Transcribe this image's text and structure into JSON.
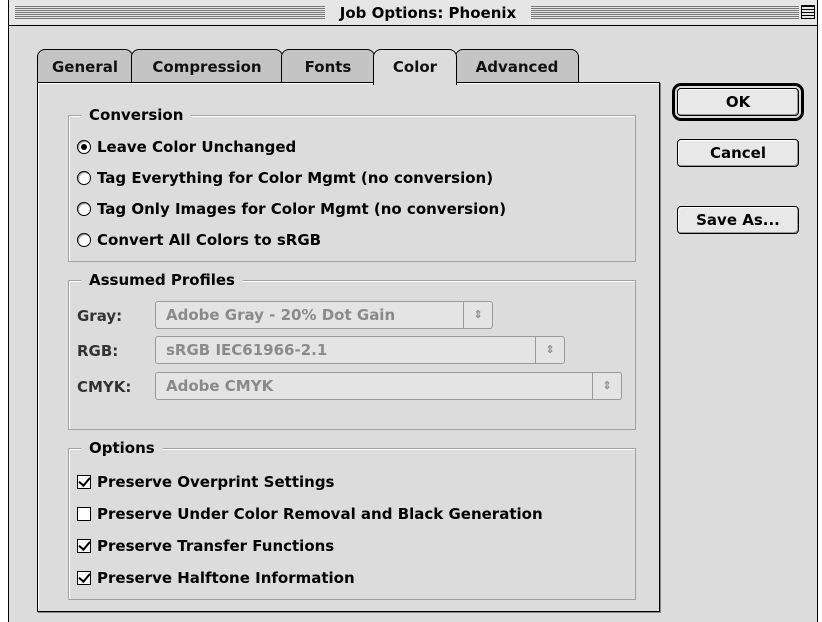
{
  "window": {
    "title": "Job Options: Phoenix"
  },
  "tabs": [
    {
      "label": "General",
      "active": false
    },
    {
      "label": "Compression",
      "active": false
    },
    {
      "label": "Fonts",
      "active": false
    },
    {
      "label": "Color",
      "active": true
    },
    {
      "label": "Advanced",
      "active": false
    }
  ],
  "conversion": {
    "title": "Conversion",
    "options": [
      {
        "label": "Leave Color Unchanged",
        "selected": true
      },
      {
        "label": "Tag Everything for Color Mgmt (no conversion)",
        "selected": false
      },
      {
        "label": "Tag Only Images for Color Mgmt (no conversion)",
        "selected": false
      },
      {
        "label": "Convert All Colors to sRGB",
        "selected": false
      }
    ]
  },
  "profiles": {
    "title": "Assumed Profiles",
    "gray": {
      "label": "Gray:",
      "value": "Adobe Gray - 20% Dot Gain"
    },
    "rgb": {
      "label": "RGB:",
      "value": "sRGB IEC61966-2.1"
    },
    "cmyk": {
      "label": "CMYK:",
      "value": "Adobe CMYK"
    },
    "popup_arrows": "⇕"
  },
  "options": {
    "title": "Options",
    "items": [
      {
        "label": "Preserve Overprint Settings",
        "checked": true
      },
      {
        "label": "Preserve Under Color Removal and Black Generation",
        "checked": false
      },
      {
        "label": "Preserve Transfer Functions",
        "checked": true
      },
      {
        "label": "Preserve Halftone Information",
        "checked": true
      }
    ]
  },
  "buttons": {
    "ok": "OK",
    "cancel": "Cancel",
    "save_as": "Save As..."
  }
}
